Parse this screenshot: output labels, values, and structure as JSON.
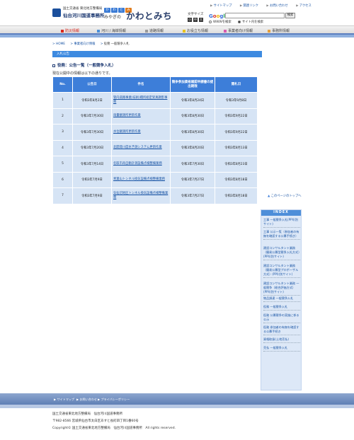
{
  "header": {
    "org_line1": "国土交通省 東北地方整備局",
    "org_line2": "仙台河川国道事務所",
    "badges": [
      "か",
      "わ",
      "と",
      "み"
    ],
    "site_sub": "みやぎの",
    "site_title": "かわとみち",
    "top_links": [
      "サイトマップ",
      "関連リンク",
      "お問い合わせ",
      "アクセス"
    ],
    "font_size_label": "文字サイズ",
    "font_size_buttons": [
      "小",
      "中",
      "大"
    ],
    "search_logo": "Google",
    "search_placeholder": "",
    "search_button": "検索",
    "radio_www": "WWWを検索",
    "radio_site": "サイト内を検索"
  },
  "nav": {
    "items": [
      {
        "label": "防災情報",
        "color": "#d9261c"
      },
      {
        "label": "河川 / 海岸情報",
        "color": "#4a90d9"
      },
      {
        "label": "道路情報",
        "color": "#9a9a9a"
      },
      {
        "label": "お役立ち情報",
        "color": "#e8c31e"
      },
      {
        "label": "事業者向け情報",
        "color": "#d85ab0"
      },
      {
        "label": "事務所情報",
        "color": "#e6a03c"
      }
    ]
  },
  "breadcrumb": [
    "HOME",
    "事業者向け情報",
    "役務 一般競争入札"
  ],
  "section_bar": "入札公告",
  "page_heading": "役務：公告一覧（一般競争入札）",
  "subtext": "現在公開中の情報は以下の通りです。",
  "table": {
    "headers": [
      "No.",
      "公告日",
      "件名",
      "競争参加資格確認申請書の提出期限",
      "開札日"
    ],
    "rows": [
      [
        "1",
        "令和3年8月2日",
        "管内道路事業(技術)積所総定受真題影事務",
        "令和3年8月24日",
        "令和3年9月8日"
      ],
      [
        "2",
        "令和3年7月30日",
        "雨量観測所更新作業",
        "令和3年8月30日",
        "令和3年9月22日"
      ],
      [
        "3",
        "令和3年7月30日",
        "水位観測所更新作業",
        "令和3年8月30日",
        "令和3年9月22日"
      ],
      [
        "4",
        "令和3年7月20日",
        "北開発川度水予測システム更新作業",
        "令和3年8月20日",
        "令和3年8月13日"
      ],
      [
        "5",
        "令和3年7月14日",
        "名取市再自動計測設備点検整備業務",
        "令和3年7月30日",
        "令和3年8月23日"
      ],
      [
        "6",
        "令和3年7月9日",
        "青葉山トンネル換気設備点検整備業務",
        "令和3年7月27日",
        "令和3年8月18日"
      ],
      [
        "7",
        "令和3年7月9日",
        "気仙沼地区トンネル換気設備点検整備業務",
        "令和3年7月27日",
        "令和3年8月18日"
      ]
    ]
  },
  "to_top": "このページのトップへ",
  "index": {
    "title": "INDEX",
    "items": [
      "工事 一般競争入札(PPI)(別サイト)",
      "工事 公示一覧（参加者の有無を確認する公募手続き）",
      "建設コンサルタント業務（簡易公募型競争入札方式）(PPI)(別サイト)",
      "建設コンサルタント業務（簡易公募型プロポーザル方式）(PPI)(別サイト)",
      "建設コンサルタント業務 一般競争（総合評価方式）(PPI)(別サイト)",
      "物品調達 一般競争入札",
      "役務 一般競争入札",
      "役務 公募競争の実施に係る公示",
      "役務 参加者の有無を確認する公募手続き",
      "資格取扱(土地売払)",
      "売払 一般競争入札"
    ]
  },
  "footer": {
    "links": [
      "サイトマップ",
      "お問い合わせ",
      "プライバシーポリシー"
    ],
    "org": "国土交通省東北地方整備局　仙台河川国道事務所",
    "address": "〒982-8566 宮城県仙台市太白区あすと長町四丁目1番60号",
    "copyright": "Copyright© 国土交通省東北地方整備局　仙台河川国道事務所　All rights reserved."
  }
}
